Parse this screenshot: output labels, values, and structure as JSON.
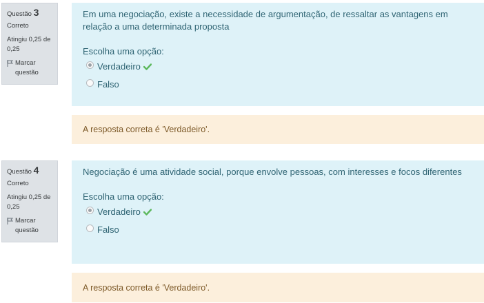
{
  "questions": [
    {
      "label": "Questão",
      "number": "3",
      "state": "Correto",
      "grade": "Atingiu 0,25 de 0,25",
      "flag_label": "Marcar questão",
      "text": "Em uma negociação, existe a necessidade de argumentação, de ressaltar as vantagens em relação a uma determinada proposta",
      "prompt": "Escolha uma opção:",
      "options": [
        {
          "label": "Verdadeiro",
          "checked": true,
          "correct_mark": true
        },
        {
          "label": "Falso",
          "checked": false,
          "correct_mark": false
        }
      ],
      "feedback": "A resposta correta é 'Verdadeiro'."
    },
    {
      "label": "Questão",
      "number": "4",
      "state": "Correto",
      "grade": "Atingiu 0,25 de 0,25",
      "flag_label": "Marcar questão",
      "text": "Negociação é uma atividade social, porque envolve pessoas, com interesses e focos diferentes",
      "prompt": "Escolha uma opção:",
      "options": [
        {
          "label": "Verdadeiro",
          "checked": true,
          "correct_mark": true
        },
        {
          "label": "Falso",
          "checked": false,
          "correct_mark": false
        }
      ],
      "feedback": "A resposta correta é 'Verdadeiro'."
    }
  ],
  "colors": {
    "info_bg": "#dee2e6",
    "formulation_bg": "#def2f8",
    "feedback_bg": "#fcefdc",
    "check_green": "#5cb85c"
  },
  "icons": {
    "flag": "flag-icon",
    "check": "checkmark-icon"
  }
}
